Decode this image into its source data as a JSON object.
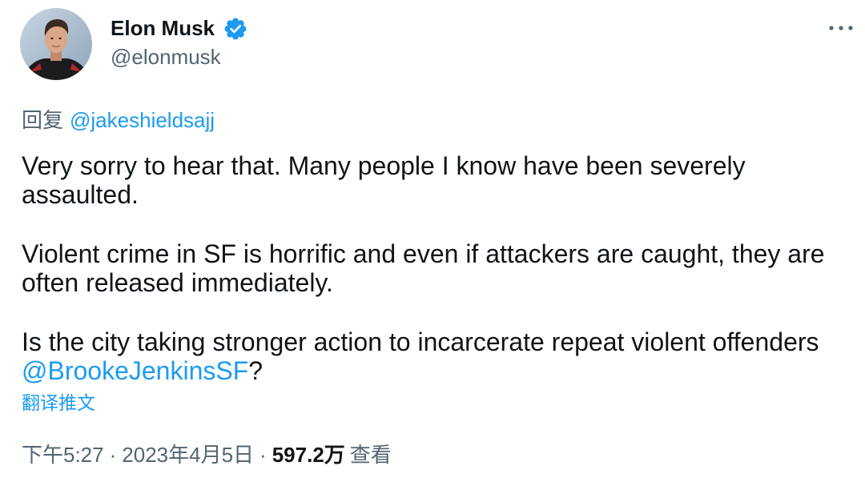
{
  "author": {
    "name": "Elon Musk",
    "handle": "@elonmusk",
    "verified": true,
    "avatar_icon": "avatar-photo",
    "badge_icon": "verified-badge-icon"
  },
  "more_icon": "more-horizontal-icon",
  "reply_context": {
    "label": "回复",
    "mention": "@jakeshieldsajj"
  },
  "body": {
    "paragraphs": [
      {
        "lines": [
          "Very sorry to hear that. Many people I know have been severely",
          "assaulted."
        ]
      },
      {
        "lines": [
          "Violent crime in SF is horrific and even if attackers are caught, they are",
          "often released immediately."
        ]
      },
      {
        "lines": [
          "Is the city taking stronger action to incarcerate repeat violent offenders"
        ],
        "mention": "@BrookeJenkinsSF",
        "tail": "?"
      }
    ]
  },
  "translate_label": "翻译推文",
  "meta": {
    "time": "下午5:27",
    "separator": "·",
    "date": "2023年4月5日",
    "views_count": "597.2万",
    "views_label": "查看"
  },
  "colors": {
    "text": "#0f1419",
    "secondary": "#536471",
    "accent": "#1d9bf0",
    "background": "#ffffff"
  }
}
